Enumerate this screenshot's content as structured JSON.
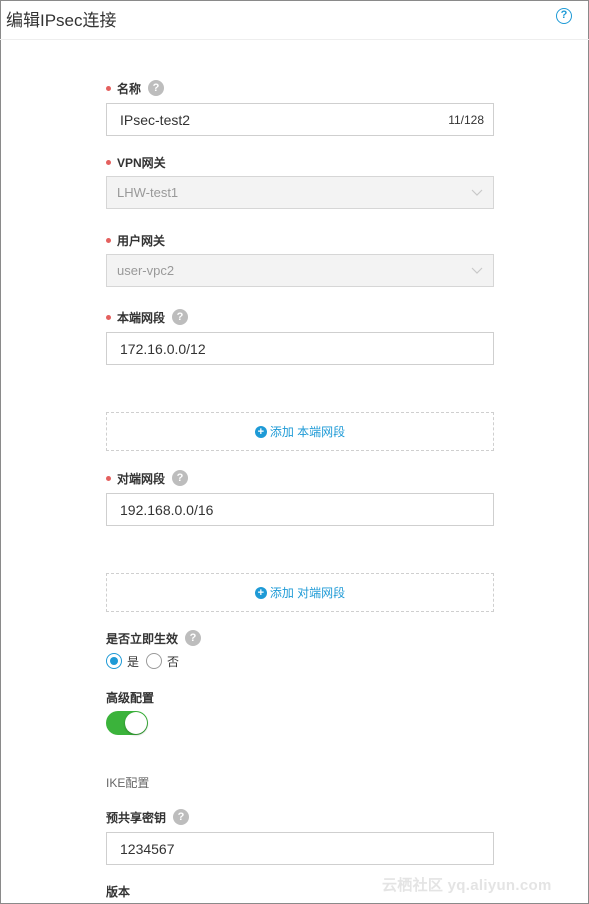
{
  "header": {
    "title": "编辑IPsec连接",
    "help_icon": "?"
  },
  "fields": {
    "name": {
      "label": "名称",
      "value": "IPsec-test2",
      "counter": "11/128"
    },
    "vpn_gateway": {
      "label": "VPN网关",
      "value": "LHW-test1"
    },
    "user_gateway": {
      "label": "用户网关",
      "value": "user-vpc2"
    },
    "local_subnet": {
      "label": "本端网段",
      "value": "172.16.0.0/12",
      "add_label": "添加 本端网段"
    },
    "remote_subnet": {
      "label": "对端网段",
      "value": "192.168.0.0/16",
      "add_label": "添加 对端网段"
    },
    "effective_immediately": {
      "label": "是否立即生效",
      "options": [
        "是",
        "否"
      ],
      "selected": "是"
    },
    "advanced": {
      "label": "高级配置",
      "enabled": true
    },
    "ike_section": "IKE配置",
    "psk": {
      "label": "预共享密钥",
      "value": "1234567"
    },
    "version": {
      "label": "版本"
    }
  },
  "help_mark": "?",
  "plus_mark": "+",
  "watermark": "云栖社区 yq.aliyun.com",
  "colors": {
    "accent": "#1e9ad6",
    "required": "#e4605e",
    "toggle_on": "#3bb33b"
  }
}
